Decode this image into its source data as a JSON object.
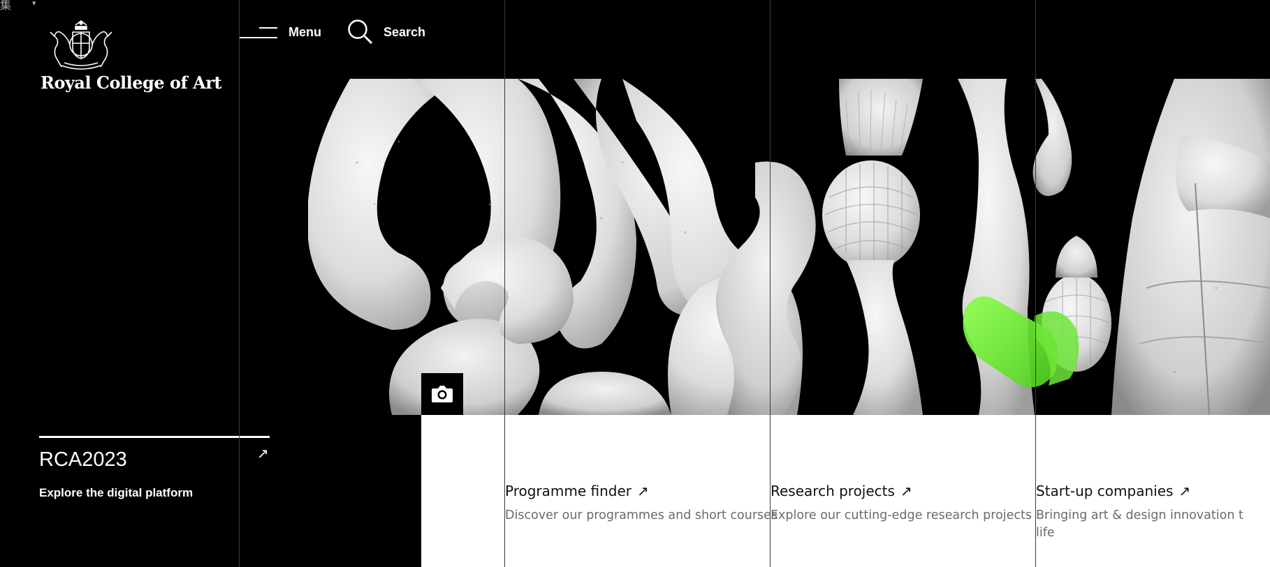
{
  "ime_indicator": "集",
  "brand": {
    "name": "Royal College of Art",
    "crest_icon": "royal-crest-icon"
  },
  "header": {
    "menu_label": "Menu",
    "search_label": "Search"
  },
  "hero": {
    "image_subject": "white carved stone sculpture with green accent",
    "camera_icon": "camera-icon"
  },
  "promo": {
    "title": "RCA2023",
    "arrow": "↗",
    "subtitle": "Explore the digital platform"
  },
  "cards": [
    {
      "title": "Programme finder",
      "arrow": "↗",
      "description": "Discover our programmes and short courses"
    },
    {
      "title": "Research projects",
      "arrow": "↗",
      "description": "Explore our cutting-edge research projects"
    },
    {
      "title": "Start-up companies",
      "arrow": "↗",
      "description": "Bringing art & design innovation t",
      "description_line2": "life"
    }
  ],
  "colors": {
    "background": "#000000",
    "panel": "#ffffff",
    "accent_green": "#7ef03a"
  }
}
